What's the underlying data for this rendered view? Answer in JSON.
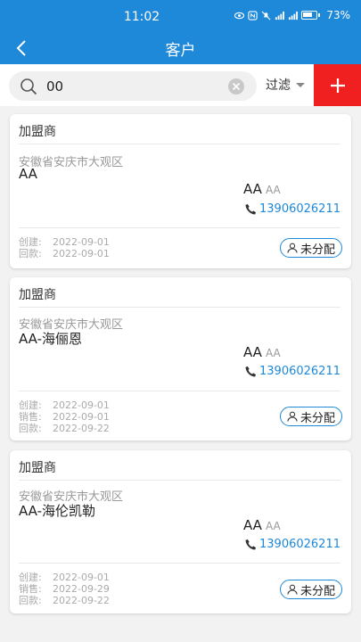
{
  "status_bar": {
    "time": "11:02",
    "battery": "73%"
  },
  "header": {
    "title": "客户"
  },
  "search": {
    "value": "00",
    "filter_label": "过滤"
  },
  "customers": [
    {
      "type": "加盟商",
      "address": "安徽省安庆市大观区",
      "name": "AA",
      "contact": "AA",
      "contact_sub": "AA",
      "phone": "13906026211",
      "dates": [
        {
          "label": "创建:",
          "value": "2022-09-01"
        },
        {
          "label": "回款:",
          "value": "2022-09-01"
        }
      ],
      "status": "未分配"
    },
    {
      "type": "加盟商",
      "address": "安徽省安庆市大观区",
      "name": "AA-海俪恩",
      "contact": "AA",
      "contact_sub": "AA",
      "phone": "13906026211",
      "dates": [
        {
          "label": "创建:",
          "value": "2022-09-01"
        },
        {
          "label": "销售:",
          "value": "2022-09-01"
        },
        {
          "label": "回款:",
          "value": "2022-09-22"
        }
      ],
      "status": "未分配"
    },
    {
      "type": "加盟商",
      "address": "安徽省安庆市大观区",
      "name": "AA-海伦凯勒",
      "contact": "AA",
      "contact_sub": "AA",
      "phone": "13906026211",
      "dates": [
        {
          "label": "创建:",
          "value": "2022-09-01"
        },
        {
          "label": "销售:",
          "value": "2022-09-29"
        },
        {
          "label": "回款:",
          "value": "2022-09-22"
        }
      ],
      "status": "未分配"
    }
  ],
  "colors": {
    "primary": "#1e88d9",
    "add_button": "#f02020",
    "background": "#f2f2f2"
  }
}
